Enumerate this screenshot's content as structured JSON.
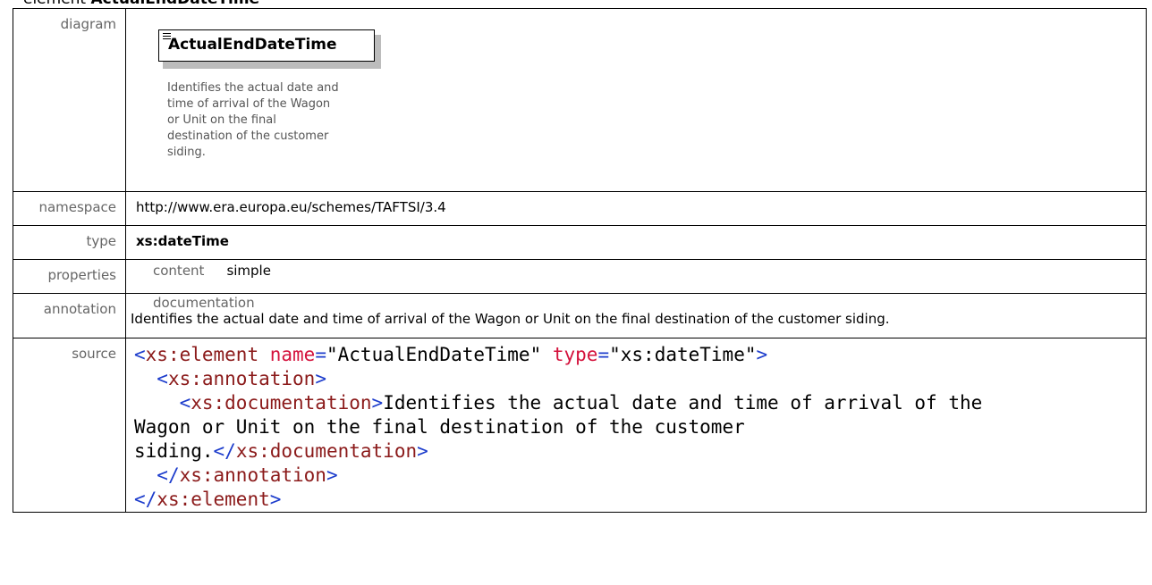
{
  "title": {
    "prefix": "element ",
    "name": "ActualEndDateTime"
  },
  "rows": {
    "diagram": {
      "label": "diagram",
      "element_name": "ActualEndDateTime",
      "doc_lines": [
        "Identifies the actual date and",
        "time of arrival of the Wagon",
        "or Unit on the final",
        "destination of the customer",
        "siding."
      ]
    },
    "namespace": {
      "label": "namespace",
      "value": "http://www.era.europa.eu/schemes/TAFTSI/3.4"
    },
    "type": {
      "label": "type",
      "value": "xs:dateTime"
    },
    "properties": {
      "label": "properties",
      "key": "content",
      "value": "simple"
    },
    "annotation": {
      "label": "annotation",
      "subheading": "documentation",
      "text": "Identifies the actual date and time of arrival of the Wagon or Unit on the final destination of the customer siding."
    },
    "source": {
      "label": "source",
      "open_tag": "xs:element",
      "attr_name": "name",
      "attr_name_val": "ActualEndDateTime",
      "attr_type": "type",
      "attr_type_val": "xs:dateTime",
      "ann_tag": "xs:annotation",
      "doc_tag": "xs:documentation",
      "doc_text_1": "Identifies the actual date and time of arrival of the",
      "doc_text_2": "Wagon or Unit on the final destination of the customer",
      "doc_text_3": "siding."
    }
  },
  "colors": {
    "tag": "#8b1a1a",
    "bracket": "#1c3ccc",
    "attr": "#d4123c",
    "label": "#666666"
  }
}
